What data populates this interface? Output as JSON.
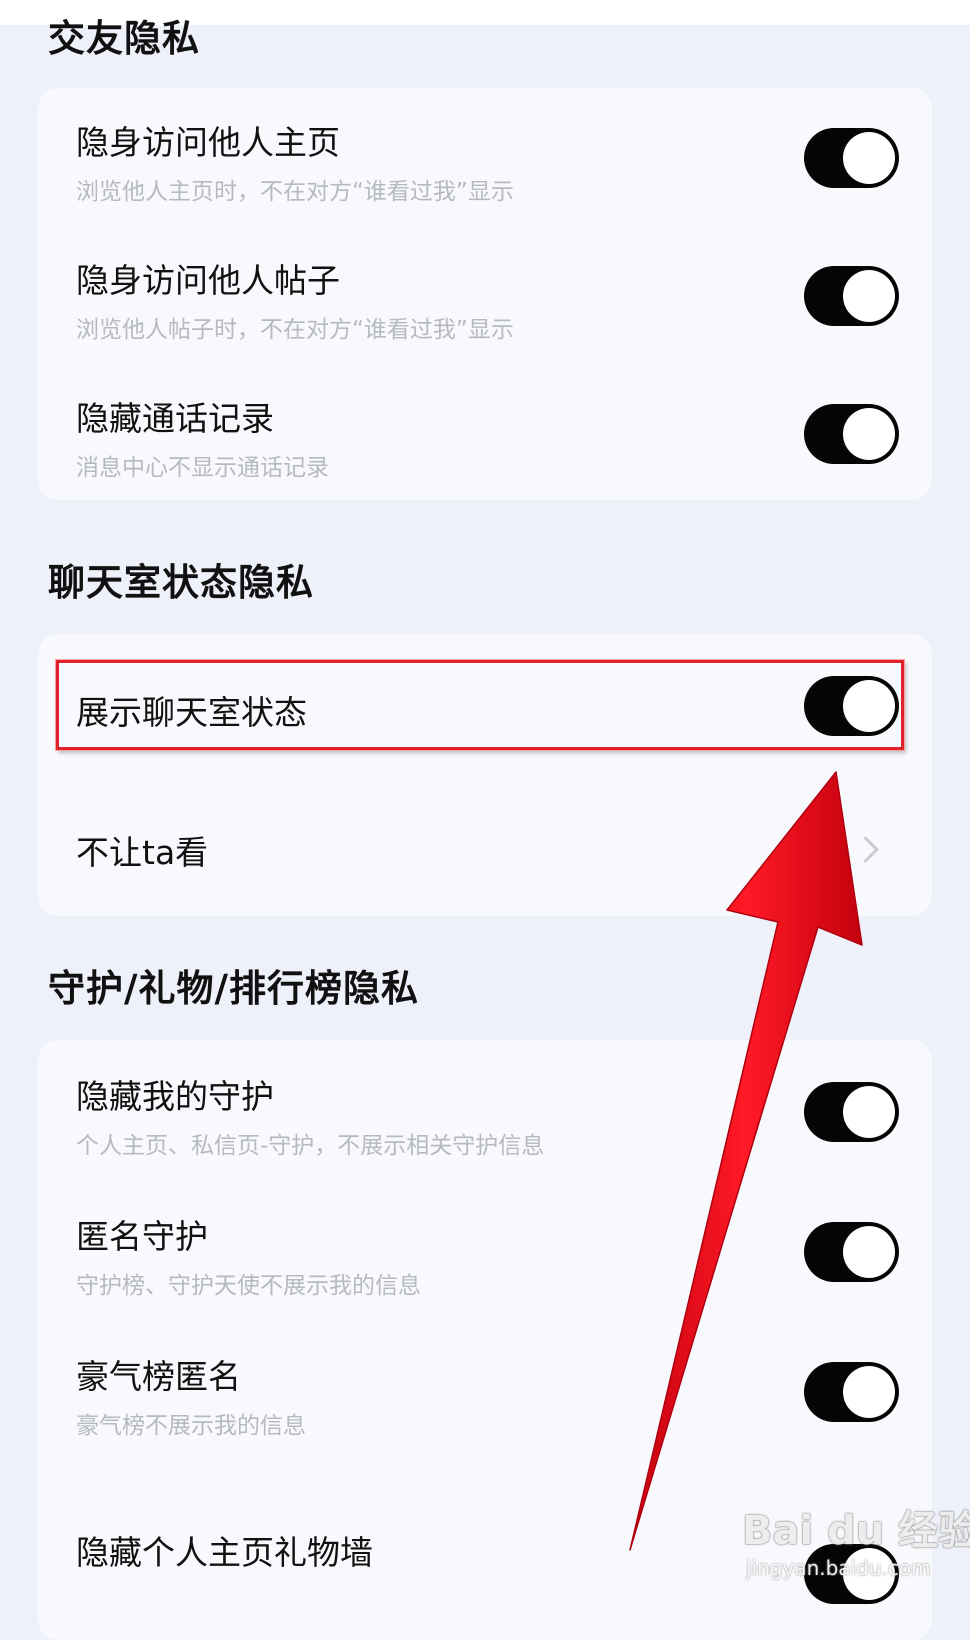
{
  "sections": [
    {
      "title": "交友隐私",
      "rows": [
        {
          "title": "隐身访问他人主页",
          "subtitle": "浏览他人主页时，不在对方“谁看过我”显示",
          "toggle": true
        },
        {
          "title": "隐身访问他人帖子",
          "subtitle": "浏览他人帖子时，不在对方“谁看过我”显示",
          "toggle": true
        },
        {
          "title": "隐藏通话记录",
          "subtitle": "消息中心不显示通话记录",
          "toggle": true
        }
      ]
    },
    {
      "title": "聊天室状态隐私",
      "rows": [
        {
          "title": "展示聊天室状态",
          "toggle": true
        },
        {
          "title": "不让ta看",
          "chevron": "chevron-right-icon"
        }
      ]
    },
    {
      "title": "守护/礼物/排行榜隐私",
      "rows": [
        {
          "title": "隐藏我的守护",
          "subtitle": "个人主页、私信页-守护，不展示相关守护信息",
          "toggle": true
        },
        {
          "title": "匿名守护",
          "subtitle": "守护榜、守护天使不展示我的信息",
          "toggle": true
        },
        {
          "title": "豪气榜匿名",
          "subtitle": "豪气榜不展示我的信息",
          "toggle": true
        },
        {
          "title": "隐藏个人主页礼物墙",
          "toggle": true
        }
      ]
    }
  ],
  "watermark": {
    "brand": "Bai du 经验",
    "url": "jingyan.baidu.com"
  },
  "colors": {
    "background": "#eef0fa",
    "card": "#f8f9fd",
    "toggle_on": "#050505",
    "annotation": "#e0202a"
  }
}
